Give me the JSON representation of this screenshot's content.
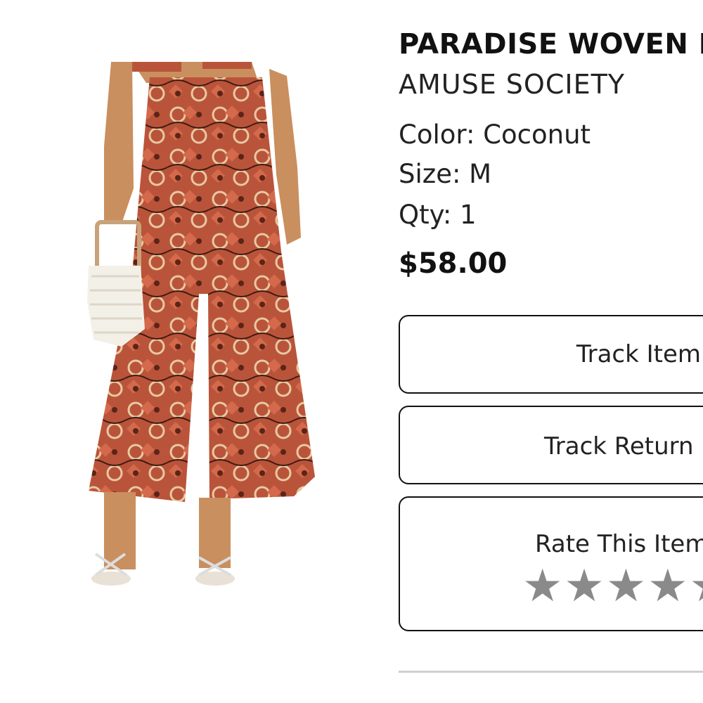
{
  "product": {
    "title": "PARADISE WOVEN P",
    "brand": "AMUSE SOCIETY",
    "color": "Color: Coconut",
    "size": "Size: M",
    "qty": "Qty: 1",
    "price": "$58.00"
  },
  "actions": {
    "track_item": "Track Item",
    "track_return": "Track Return",
    "rate_item": "Rate This Item",
    "rating": {
      "value": 0,
      "max": 5,
      "stars": "★★★★★"
    }
  },
  "colors": {
    "text": "#111111",
    "star": "#8a8a8a",
    "fabric": "#b9543a",
    "divider": "#cfcfcf"
  }
}
